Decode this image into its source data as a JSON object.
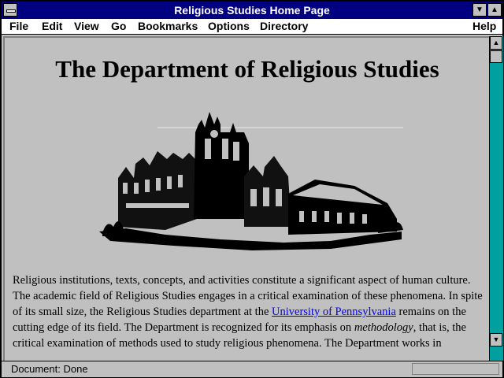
{
  "window": {
    "title": "Religious Studies Home Page"
  },
  "menubar": {
    "items": [
      {
        "label": "File"
      },
      {
        "label": "Edit"
      },
      {
        "label": "View"
      },
      {
        "label": "Go"
      },
      {
        "label": "Bookmarks"
      },
      {
        "label": "Options"
      },
      {
        "label": "Directory"
      },
      {
        "label": "Help"
      }
    ]
  },
  "page": {
    "heading": "The Department of Religious Studies",
    "image": {
      "icon": "university-building-sketch"
    },
    "paragraph": {
      "part1": "Religious institutions, texts, concepts, and activities constitute a significant aspect of human culture. The academic field of Religious Studies engages in a critical examination of these phenomena. In spite of its small size, the Religious Studies department at the ",
      "link": "University of Pennsylvania",
      "part2": " remains on the cutting edge of its field. The Department is recognized for its emphasis on ",
      "emphasis": "methodology",
      "part3": ", that is, the critical examination of methods used to study religious phenomena. The Department works in"
    }
  },
  "status": {
    "text": "Document: Done"
  },
  "colors": {
    "titlebar": "#000080",
    "link": "#0000ee",
    "scroll_track": "#00a0a0",
    "background": "#c0c0c0"
  }
}
